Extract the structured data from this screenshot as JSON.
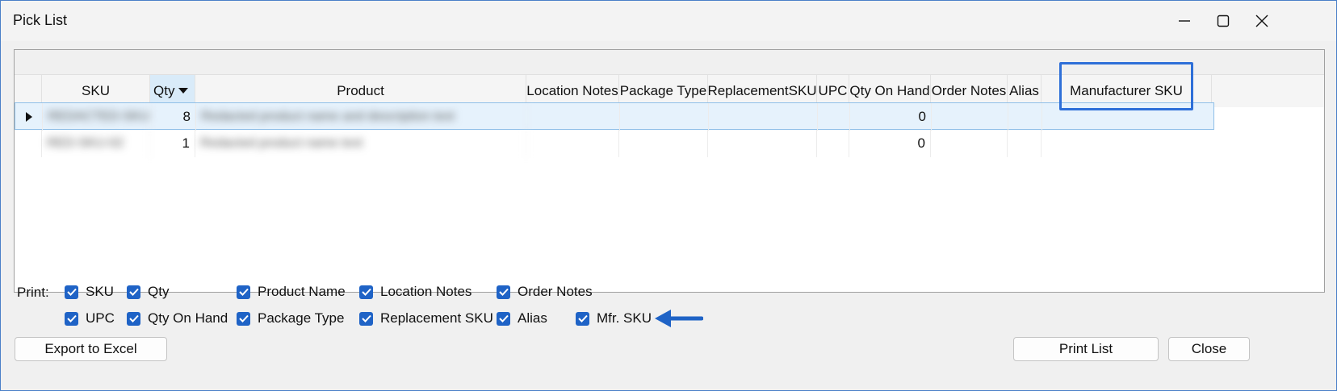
{
  "window": {
    "title": "Pick List"
  },
  "grid": {
    "columns": [
      "",
      "SKU",
      "Qty",
      "Product",
      "Location Notes",
      "Package Type",
      "ReplacementSKU",
      "UPC",
      "Qty On Hand",
      "Order Notes",
      "Alias",
      "Manufacturer SKU"
    ],
    "rows": [
      {
        "sku": "REDACTED-SKU-01",
        "qty": "8",
        "product": "Redacted product name and description text",
        "qty_on_hand": "0"
      },
      {
        "sku": "RED-SKU-02",
        "qty": "1",
        "product": "Redacted product name text",
        "qty_on_hand": "0"
      }
    ]
  },
  "print": {
    "label": "Print:",
    "options_row1": [
      "SKU",
      "Qty",
      "Product Name",
      "Location Notes",
      "Order Notes"
    ],
    "options_row2": [
      "UPC",
      "Qty On Hand",
      "Package Type",
      "Replacement SKU",
      "Alias",
      "Mfr. SKU"
    ]
  },
  "buttons": {
    "export": "Export to Excel",
    "print": "Print List",
    "close": "Close"
  },
  "colors": {
    "accent": "#1f63c6",
    "highlight": "#2e6fd8",
    "selected_row": "#e6f2fc"
  }
}
